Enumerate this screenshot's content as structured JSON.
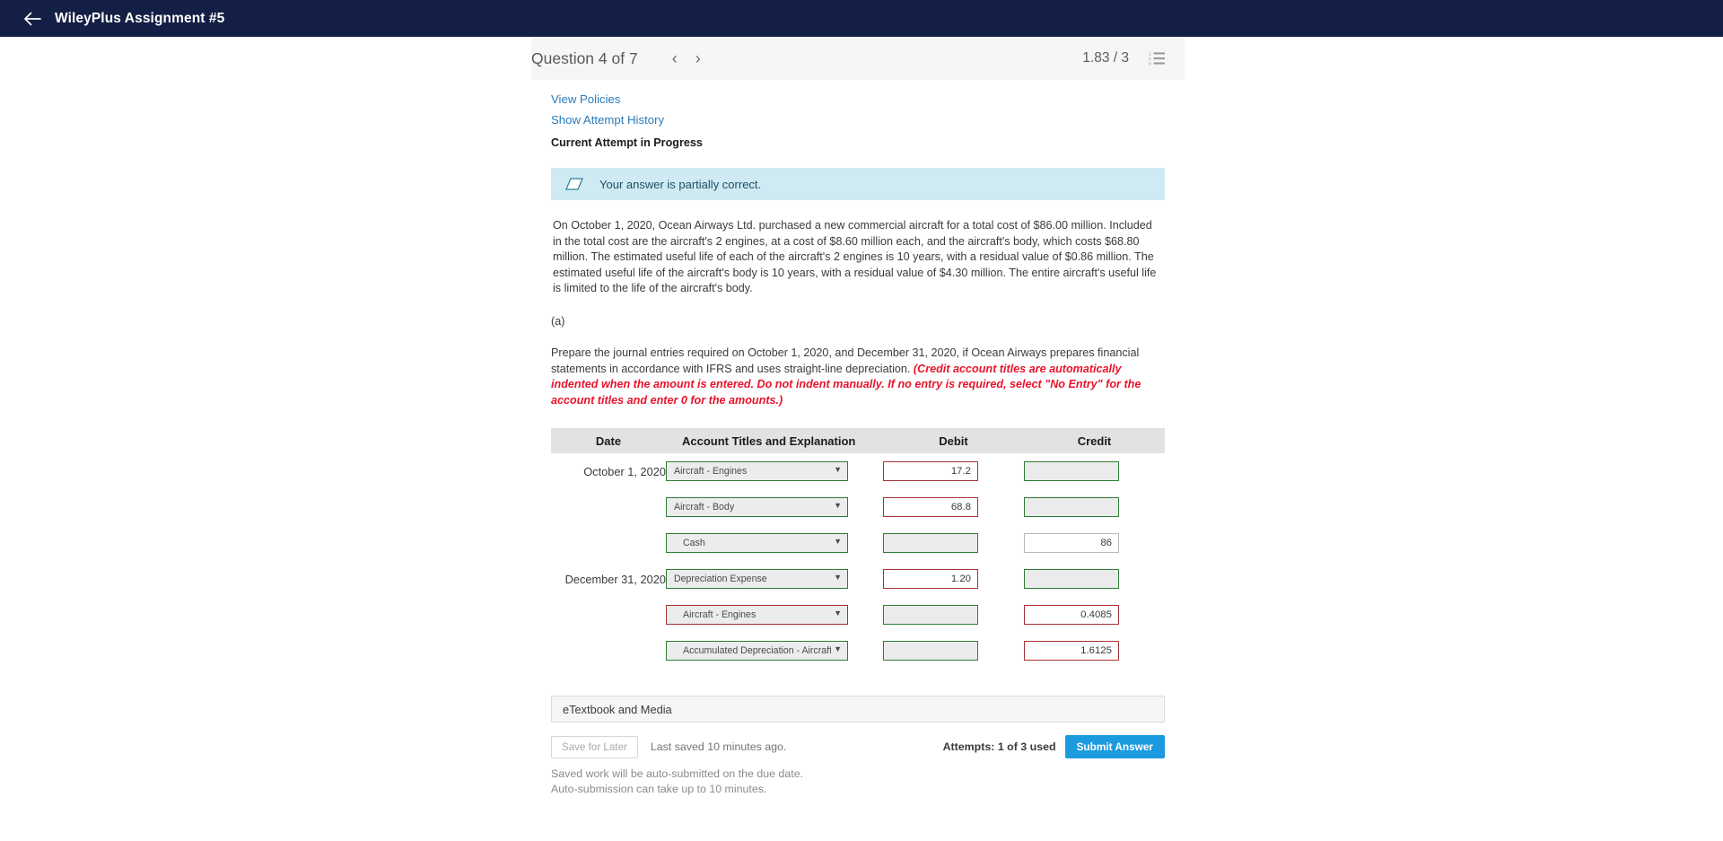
{
  "appbar": {
    "back_icon": "arrow-left-icon",
    "title": "WileyPlus Assignment #5",
    "bg_color": "#141f45"
  },
  "question_header": {
    "title": "Question 4 of 7",
    "prev_icon": "chevron-left-icon",
    "next_icon": "chevron-right-icon",
    "prev_label": "‹",
    "next_label": "›",
    "score": "1.83 / 3",
    "list_icon": "numbered-list-icon"
  },
  "links": {
    "view_policies": "View Policies",
    "show_attempt_history": "Show Attempt History",
    "current_attempt": "Current Attempt in Progress"
  },
  "alert": {
    "icon": "partially-correct-icon",
    "text": "Your answer is partially correct.",
    "bg_color": "#cfeaf3",
    "text_color": "#1c4f63"
  },
  "problem": {
    "paragraph": "On October 1, 2020, Ocean Airways Ltd. purchased a new commercial aircraft for a total cost of $86.00 million. Included in the total cost are the aircraft's 2 engines, at a cost of $8.60 million each, and the aircraft's body, which costs $68.80 million. The estimated useful life of each of the aircraft's 2 engines is 10 years, with a residual value of $0.86 million. The estimated useful life of the aircraft's body is 10 years, with a residual value of $4.30 million. The entire aircraft's useful life is limited to the life of the aircraft's body.",
    "part_label": "(a)",
    "instruction_main": "Prepare the journal entries required on October 1, 2020, and December 31, 2020, if Ocean Airways prepares financial statements in accordance with IFRS and uses straight-line depreciation.",
    "instruction_note": "(Credit account titles are automatically indented when the amount is entered. Do not indent manually. If no entry is required, select \"No Entry\" for the account titles and enter 0 for the amounts.)",
    "note_color": "#e8132b"
  },
  "journal": {
    "headers": {
      "date": "Date",
      "account": "Account Titles and Explanation",
      "debit": "Debit",
      "credit": "Credit"
    },
    "rows": [
      {
        "date": "October 1, 2020",
        "account": "Aircraft - Engines",
        "account_state": "ok",
        "indent": false,
        "debit": "17.2",
        "debit_state": "error",
        "credit": "",
        "credit_state": "locked"
      },
      {
        "date": "",
        "account": "Aircraft - Body",
        "account_state": "ok",
        "indent": false,
        "debit": "68.8",
        "debit_state": "error",
        "credit": "",
        "credit_state": "locked"
      },
      {
        "date": "",
        "account": "Cash",
        "account_state": "ok",
        "indent": true,
        "debit": "",
        "debit_state": "locked",
        "credit": "86",
        "credit_state": "plain"
      },
      {
        "date": "December 31, 2020",
        "account": "Depreciation Expense",
        "account_state": "ok",
        "indent": false,
        "debit": "1.20",
        "debit_state": "error",
        "credit": "",
        "credit_state": "locked"
      },
      {
        "date": "",
        "account": "Aircraft - Engines",
        "account_state": "error",
        "indent": true,
        "debit": "",
        "debit_state": "locked",
        "credit": "0.4085",
        "credit_state": "error"
      },
      {
        "date": "",
        "account": "Accumulated Depreciation - Aircraft - Body",
        "account_state": "ok",
        "indent": true,
        "debit": "",
        "debit_state": "locked",
        "credit": "1.6125",
        "credit_state": "error"
      }
    ],
    "dropdown_chevron": "chevron-down-icon",
    "border_ok_color": "#2e7d32",
    "border_error_color": "#a83232"
  },
  "etextbook": {
    "label": "eTextbook and Media"
  },
  "footer": {
    "save_label": "Save for Later",
    "last_saved": "Last saved 10 minutes ago.",
    "attempts": "Attempts: 1 of 3 used",
    "submit_label": "Submit Answer",
    "autosave_note": "Saved work will be auto-submitted on the due date. Auto-submission can take up to 10 minutes.",
    "submit_color": "#1b9ae0"
  }
}
